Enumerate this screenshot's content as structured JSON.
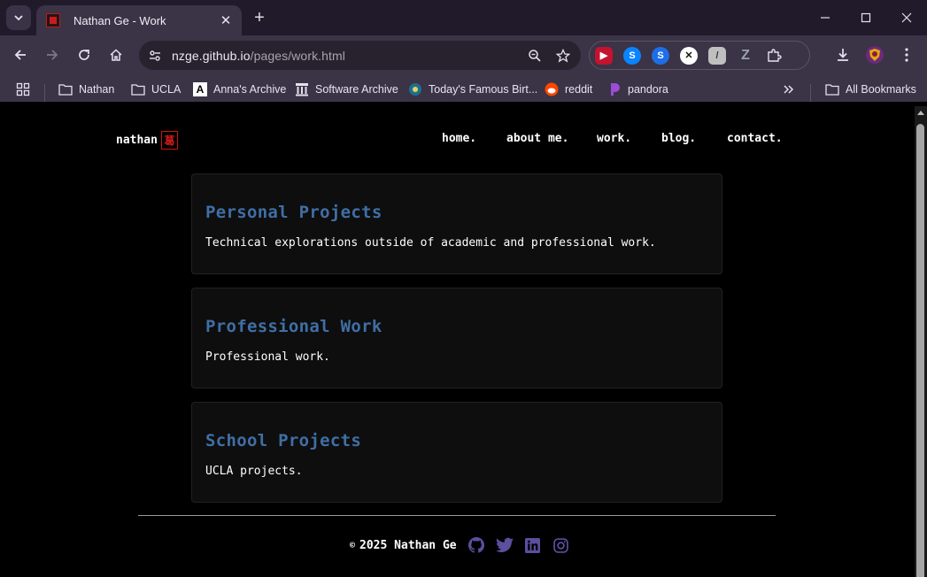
{
  "browser": {
    "tab_title": "Nathan Ge - Work",
    "url_host": "nzge.github.io",
    "url_path": "/pages/work.html",
    "bookmarks": [
      "Nathan",
      "UCLA",
      "Anna's Archive",
      "Software Archive",
      "Today's Famous Birt...",
      "reddit",
      "pandora"
    ],
    "all_bookmarks": "All Bookmarks"
  },
  "site": {
    "logo_text": "nathan",
    "logo_seal": "葛",
    "nav": [
      "home.",
      "about me.",
      "work.",
      "blog.",
      "contact."
    ]
  },
  "cards": [
    {
      "title": "Personal Projects",
      "desc": "Technical explorations outside of academic and professional work."
    },
    {
      "title": "Professional Work",
      "desc": "Professional work."
    },
    {
      "title": "School Projects",
      "desc": "UCLA projects."
    }
  ],
  "footer": {
    "copyright_symbol": "©",
    "text": "2025 Nathan Ge",
    "social_icons": [
      "github-icon",
      "twitter-icon",
      "linkedin-icon",
      "instagram-icon"
    ]
  },
  "colors": {
    "accent": "#3f6fa6",
    "social": "#5b4f9e",
    "seal": "#c81414"
  }
}
